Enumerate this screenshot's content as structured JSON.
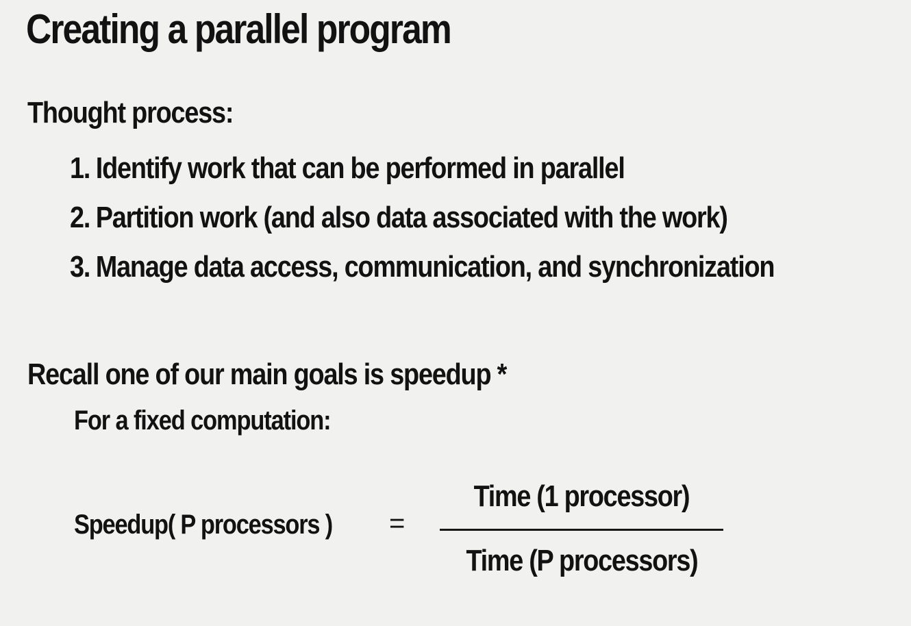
{
  "title": "Creating a parallel program",
  "thought_heading": "Thought process:",
  "steps": [
    {
      "number": "1.",
      "text": "Identify work that can be performed in parallel"
    },
    {
      "number": "2.",
      "text": "Partition work (and also data associated with the work)"
    },
    {
      "number": "3.",
      "text": "Manage data access, communication, and synchronization"
    }
  ],
  "recall_heading": "Recall one of our main goals is speedup *",
  "fixed_computation": "For a fixed computation:",
  "formula": {
    "lhs": "Speedup( P processors )",
    "equals": "=",
    "numerator": "Time (1 processor)",
    "denominator": "Time (P processors)"
  }
}
